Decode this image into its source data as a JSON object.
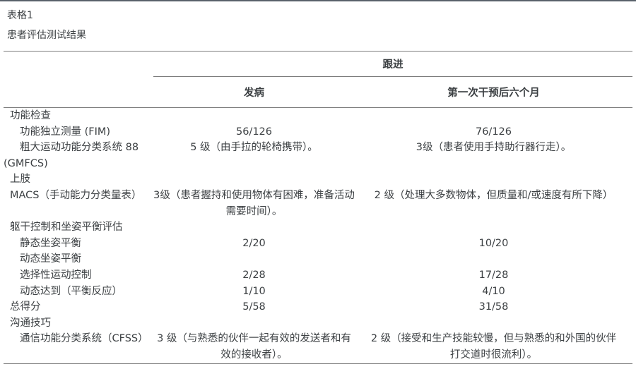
{
  "caption": {
    "label": "表格1",
    "title": "患者评估测试结果"
  },
  "table": {
    "header": {
      "followup": "跟进",
      "onset": "发病",
      "six_months": "第一次干预后六个月"
    },
    "rows": [
      {
        "label": "功能检查",
        "onset": "",
        "six_months": ""
      },
      {
        "label": "功能独立测量 (FIM)",
        "onset": "56/126",
        "six_months": "76/126"
      },
      {
        "label": "粗大运动功能分类系统 88 (GMFCS)",
        "onset": "5 级（由手拉的轮椅携带）。",
        "six_months": "3级（患者使用手持助行器行走）。"
      },
      {
        "label": "上肢",
        "onset": "",
        "six_months": ""
      },
      {
        "label": "MACS（手动能力分类量表）",
        "onset": "3级（患者握持和使用物体有困难，准备活动需要时间）。",
        "six_months": "2 级（处理大多数物体，但质量和/或速度有所下降）"
      },
      {
        "label": "躯干控制和坐姿平衡评估",
        "onset": "",
        "six_months": ""
      },
      {
        "label": "静态坐姿平衡",
        "onset": "2/20",
        "six_months": "10/20"
      },
      {
        "label": "动态坐姿平衡",
        "onset": "",
        "six_months": ""
      },
      {
        "label": "选择性运动控制",
        "onset": "2/28",
        "six_months": "17/28"
      },
      {
        "label": "动态达到（平衡反应）",
        "onset": "1/10",
        "six_months": "4/10"
      },
      {
        "label": "总得分",
        "onset": "5/58",
        "six_months": "31/58"
      },
      {
        "label": "沟通技巧",
        "onset": "",
        "six_months": ""
      },
      {
        "label": "通信功能分类系统（CFSS）",
        "onset": "3 级（与熟悉的伙伴一起有效的发送者和有效的接收者）。",
        "six_months": "2 级（接受和生产技能较慢，但与熟悉的和外国的伙伴打交道时很流利）。"
      }
    ],
    "colors": {
      "rule": "#7b7b7b",
      "top_border": "#59626a",
      "text": "#3c4043"
    }
  }
}
